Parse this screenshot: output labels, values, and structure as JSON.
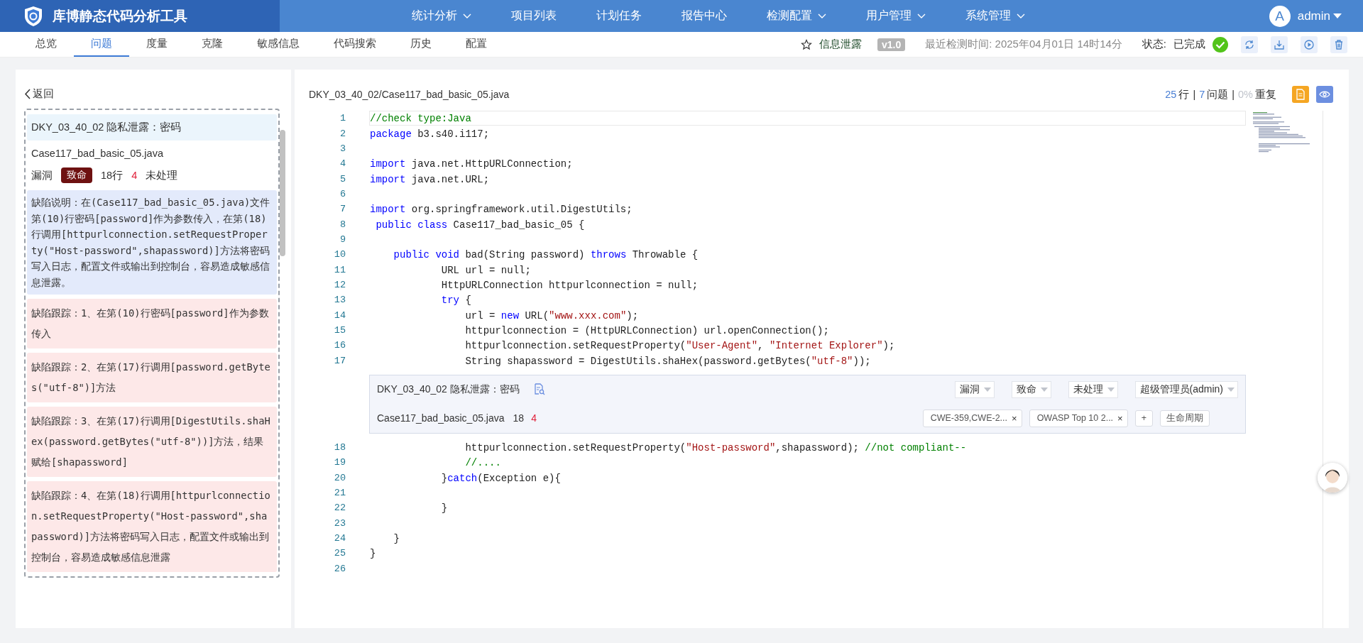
{
  "app": {
    "title": "库博静态代码分析工具"
  },
  "nav": [
    {
      "label": "统计分析",
      "dropdown": true
    },
    {
      "label": "项目列表",
      "dropdown": false
    },
    {
      "label": "计划任务",
      "dropdown": false
    },
    {
      "label": "报告中心",
      "dropdown": false
    },
    {
      "label": "检测配置",
      "dropdown": true
    },
    {
      "label": "用户管理",
      "dropdown": true
    },
    {
      "label": "系统管理",
      "dropdown": true
    }
  ],
  "user": {
    "avatar": "A",
    "name": "admin"
  },
  "tabs": [
    {
      "label": "总览",
      "selected": false
    },
    {
      "label": "问题",
      "selected": true
    },
    {
      "label": "度量",
      "selected": false
    },
    {
      "label": "克隆",
      "selected": false
    },
    {
      "label": "敏感信息",
      "selected": false
    },
    {
      "label": "代码搜索",
      "selected": false
    },
    {
      "label": "历史",
      "selected": false
    },
    {
      "label": "配置",
      "selected": false
    }
  ],
  "project": {
    "name": "信息泄露",
    "version": "v1.0",
    "last_scan": "最近检测时间: 2025年04月01日 14时14分",
    "status_label": "状态:",
    "status": "已完成"
  },
  "issue_panel": {
    "back": "返回",
    "title": "DKY_03_40_02 隐私泄露：密码",
    "file": "Case117_bad_basic_05.java",
    "type": "漏洞",
    "severity": "致命",
    "line": "18行",
    "count": "4",
    "state": "未处理",
    "details": [
      {
        "kind": "description",
        "text": "缺陷说明：在(Case117_bad_basic_05.java)文件第(10)行密码[password]作为参数传入，在第(18)行调用[httpurlconnection.setRequestProperty(\"Host-password\",shapassword)]方法将密码写入日志，配置文件或输出到控制台，容易造成敏感信息泄露。"
      },
      {
        "kind": "trace",
        "text": "缺陷跟踪：1、在第(10)行密码[password]作为参数传入"
      },
      {
        "kind": "trace",
        "text": "缺陷跟踪：2、在第(17)行调用[password.getBytes(\"utf-8\")]方法"
      },
      {
        "kind": "trace",
        "text": "缺陷跟踪：3、在第(17)行调用[DigestUtils.shaHex(password.getBytes(\"utf-8\"))]方法，结果赋给[shapassword]"
      },
      {
        "kind": "trace",
        "text": "缺陷跟踪：4、在第(18)行调用[httpurlconnection.setRequestProperty(\"Host-password\",shapassword)]方法将密码写入日志，配置文件或输出到控制台，容易造成敏感信息泄露"
      }
    ]
  },
  "code": {
    "path": "DKY_03_40_02/Case117_bad_basic_05.java",
    "stats": [
      {
        "number": "25",
        "label": "行",
        "separator": "|",
        "color": "#4a7fd4"
      },
      {
        "number": "7",
        "label": "问题",
        "separator": "|",
        "color": "#4a7fd4"
      },
      {
        "number": "0%",
        "label": "重复",
        "color": "#c0c4cc"
      }
    ],
    "lines": [
      {
        "kind": "code",
        "number": "1",
        "current": true,
        "tokens": [
          {
            "kind": "comment",
            "text": "//check type:Java"
          }
        ]
      },
      {
        "kind": "code",
        "number": "2",
        "current": false,
        "tokens": [
          {
            "kind": "keyword",
            "text": "package"
          },
          {
            "kind": "plain",
            "text": " b3.s40.i117;"
          }
        ]
      },
      {
        "kind": "code",
        "number": "3",
        "current": false
      },
      {
        "kind": "code",
        "number": "4",
        "current": false,
        "tokens": [
          {
            "kind": "keyword",
            "text": "import"
          },
          {
            "kind": "plain",
            "text": " java.net.HttpURLConnection;"
          }
        ]
      },
      {
        "kind": "code",
        "number": "5",
        "current": false,
        "tokens": [
          {
            "kind": "keyword",
            "text": "import"
          },
          {
            "kind": "plain",
            "text": " java.net.URL;"
          }
        ]
      },
      {
        "kind": "code",
        "number": "6",
        "current": false
      },
      {
        "kind": "code",
        "number": "7",
        "current": false,
        "tokens": [
          {
            "kind": "keyword",
            "text": "import"
          },
          {
            "kind": "plain",
            "text": " org.springframework.util.DigestUtils;"
          }
        ]
      },
      {
        "kind": "code",
        "number": "8",
        "current": false,
        "tokens": [
          {
            "kind": "keyword",
            "text": " public class"
          },
          {
            "kind": "plain",
            "text": " Case117_bad_basic_05 {"
          }
        ]
      },
      {
        "kind": "code",
        "number": "9",
        "current": false
      },
      {
        "kind": "code",
        "number": "10",
        "current": false,
        "tokens": [
          {
            "kind": "keyword",
            "text": "    public void"
          },
          {
            "kind": "plain",
            "text": " bad(String password) "
          },
          {
            "kind": "keyword",
            "text": "throws"
          },
          {
            "kind": "plain",
            "text": " Throwable {"
          }
        ]
      },
      {
        "kind": "code",
        "number": "11",
        "current": false,
        "tokens": [
          {
            "kind": "plain",
            "text": "            URL url = null;"
          }
        ]
      },
      {
        "kind": "code",
        "number": "12",
        "current": false,
        "tokens": [
          {
            "kind": "plain",
            "text": "            HttpURLConnection httpurlconnection = null;"
          }
        ]
      },
      {
        "kind": "code",
        "number": "13",
        "current": false,
        "tokens": [
          {
            "kind": "keyword",
            "text": "            try"
          },
          {
            "kind": "plain",
            "text": " {"
          }
        ]
      },
      {
        "kind": "code",
        "number": "14",
        "current": false,
        "tokens": [
          {
            "kind": "plain",
            "text": "                url = "
          },
          {
            "kind": "keyword",
            "text": "new"
          },
          {
            "kind": "plain",
            "text": " URL("
          },
          {
            "kind": "string",
            "text": "\"www.xxx.com\""
          },
          {
            "kind": "plain",
            "text": ");"
          }
        ]
      },
      {
        "kind": "code",
        "number": "15",
        "current": false,
        "tokens": [
          {
            "kind": "plain",
            "text": "                httpurlconnection = (HttpURLConnection) url.openConnection();"
          }
        ]
      },
      {
        "kind": "code",
        "number": "16",
        "current": false,
        "tokens": [
          {
            "kind": "plain",
            "text": "                httpurlconnection.setRequestProperty("
          },
          {
            "kind": "string",
            "text": "\"User-Agent\""
          },
          {
            "kind": "plain",
            "text": ", "
          },
          {
            "kind": "string",
            "text": "\"Internet Explorer\""
          },
          {
            "kind": "plain",
            "text": ");"
          }
        ]
      },
      {
        "kind": "code",
        "number": "17",
        "current": false,
        "tokens": [
          {
            "kind": "plain",
            "text": "                String shapassword = DigestUtils.shaHex(password.getBytes("
          },
          {
            "kind": "string",
            "text": "\"utf-8\""
          },
          {
            "kind": "plain",
            "text": "));"
          }
        ]
      },
      {
        "kind": "issue",
        "title": "DKY_03_40_02 隐私泄露：密码",
        "file": "Case117_bad_basic_05.java",
        "line": "18",
        "count": "4",
        "selects": [
          {
            "value": "漏洞"
          },
          {
            "value": "致命"
          },
          {
            "value": "未处理"
          },
          {
            "value": "超级管理员(admin)"
          }
        ],
        "tags": [
          {
            "label": "CWE-359,CWE-2...",
            "remove": "×"
          },
          {
            "label": "OWASP Top 10 2...",
            "remove": "×"
          }
        ],
        "add": "+",
        "lifecycle": "生命周期"
      },
      {
        "kind": "code",
        "number": "18",
        "current": false,
        "tokens": [
          {
            "kind": "plain",
            "text": "                httpurlconnection.setRequestProperty("
          },
          {
            "kind": "string",
            "text": "\"Host-password\""
          },
          {
            "kind": "plain",
            "text": ",shapassword); "
          },
          {
            "kind": "comment",
            "text": "//not compliant--"
          }
        ]
      },
      {
        "kind": "code",
        "number": "19",
        "current": false,
        "tokens": [
          {
            "kind": "comment",
            "text": "                //...."
          }
        ]
      },
      {
        "kind": "code",
        "number": "20",
        "current": false,
        "tokens": [
          {
            "kind": "plain",
            "text": "            }"
          },
          {
            "kind": "keyword",
            "text": "catch"
          },
          {
            "kind": "plain",
            "text": "(Exception e){"
          }
        ]
      },
      {
        "kind": "code",
        "number": "21",
        "current": false
      },
      {
        "kind": "code",
        "number": "22",
        "current": false,
        "tokens": [
          {
            "kind": "plain",
            "text": "            }"
          }
        ]
      },
      {
        "kind": "code",
        "number": "23",
        "current": false
      },
      {
        "kind": "code",
        "number": "24",
        "current": false,
        "tokens": [
          {
            "kind": "plain",
            "text": "    }"
          }
        ]
      },
      {
        "kind": "code",
        "number": "25",
        "current": false,
        "tokens": [
          {
            "kind": "plain",
            "text": "}"
          }
        ]
      },
      {
        "kind": "code",
        "number": "26",
        "current": false
      }
    ]
  }
}
